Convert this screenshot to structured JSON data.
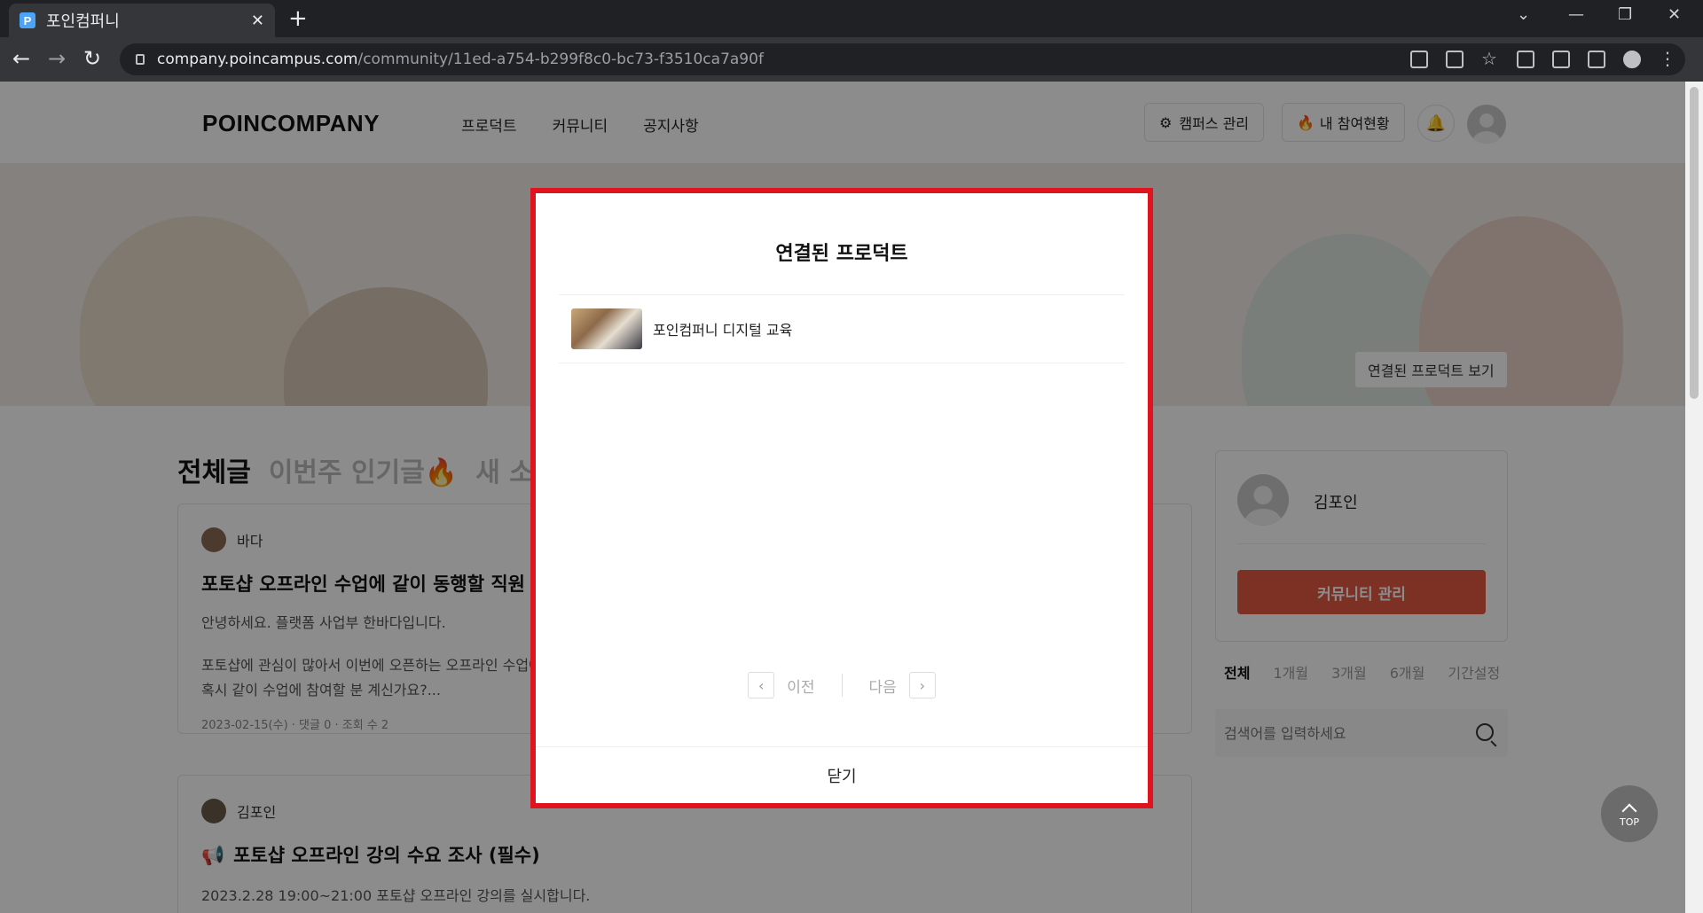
{
  "browser": {
    "tab_title": "포인컴퍼니",
    "favicon_letter": "P",
    "url_domain": "company.poincampus.com",
    "url_path": "/community/11ed-a754-b299f8c0-bc73-f3510ca7a90f"
  },
  "header": {
    "logo": "POINCOMPANY",
    "nav": [
      "프로덕트",
      "커뮤니티",
      "공지사항"
    ],
    "campus_admin": "캠퍼스 관리",
    "my_participation": "내 참여현황"
  },
  "banner": {
    "tooltip": "연결된 프로덕트 보기"
  },
  "feed": {
    "tabs": [
      "전체글",
      "이번주 인기글🔥",
      "새 소식"
    ],
    "posts": [
      {
        "author": "바다",
        "title": "포토샵 오프라인 수업에 같이 동행할 직원 있",
        "body1": "안녕하세요. 플랫폼 사업부 한바다입니다.",
        "body2": "포토샵에 관심이 많아서 이번에 오픈하는 오프라인 수업에",
        "body3": "혹시 같이 수업에 참여할 분 계신가요?...",
        "meta": "2023-02-15(수) · 댓글 0 · 조회 수 2"
      },
      {
        "author": "김포인",
        "title": "포토샵 오프라인 강의 수요 조사 (필수)",
        "body1": "2023.2.28 19:00~21:00 포토샵 오프라인 강의를 실시합니다."
      }
    ]
  },
  "sidebar": {
    "user_name": "김포인",
    "manage_button": "커뮤니티 관리",
    "periods": [
      "전체",
      "1개월",
      "3개월",
      "6개월",
      "기간설정"
    ],
    "search_placeholder": "검색어를 입력하세요"
  },
  "modal": {
    "title": "연결된 프로덕트",
    "products": [
      {
        "name": "포인컴퍼니 디지털 교육"
      }
    ],
    "prev": "이전",
    "next": "다음",
    "close": "닫기"
  },
  "top_button": "TOP",
  "colors": {
    "accent_red": "#e25a43",
    "highlight": "#e0141e"
  }
}
